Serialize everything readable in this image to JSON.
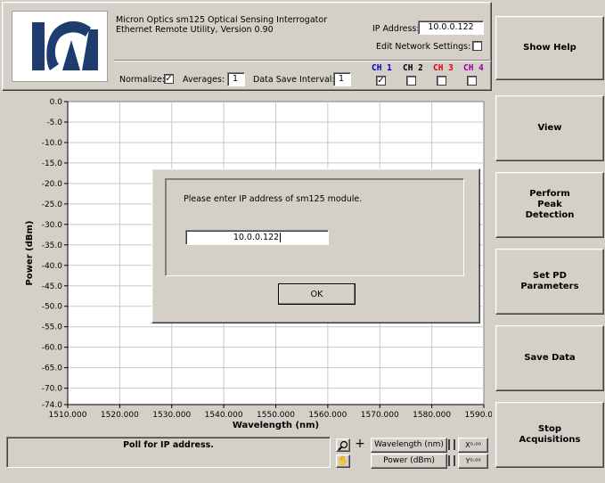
{
  "header": {
    "line1": "Micron Optics sm125 Optical Sensing Interrogator",
    "line2": "Ethernet Remote Utility, Version 0.90",
    "ip_label": "IP Address:",
    "ip_value": "10.0.0.122",
    "edit_net_label": "Edit Network Settings:",
    "normalize_label": "Normalize:",
    "averages_label": "Averages:",
    "averages_value": "1",
    "save_interval_label": "Data Save Interval:",
    "save_interval_value": "1",
    "channels": [
      {
        "label": "CH 1",
        "color": "#0000c0",
        "checked": true
      },
      {
        "label": "CH 2",
        "color": "#000000",
        "checked": false
      },
      {
        "label": "CH 3",
        "color": "#e00000",
        "checked": false
      },
      {
        "label": "CH 4",
        "color": "#a000a0",
        "checked": false
      }
    ]
  },
  "buttons": {
    "show_help": "Show Help",
    "view": "View",
    "peak": "Perform\nPeak\nDetection",
    "setpd": "Set PD\nParameters",
    "save": "Save Data",
    "stop": "Stop\nAcquisitions"
  },
  "chart_data": {
    "type": "line",
    "xlabel": "Wavelength (nm)",
    "ylabel": "Power (dBm)",
    "xlim": [
      1510,
      1590
    ],
    "ylim": [
      -74,
      0
    ],
    "x_ticks": [
      "1510.000",
      "1520.000",
      "1530.000",
      "1540.000",
      "1550.000",
      "1560.000",
      "1570.000",
      "1580.000",
      "1590.000"
    ],
    "y_ticks": [
      "0.0",
      "-5.0",
      "-10.0",
      "-15.0",
      "-20.0",
      "-25.0",
      "-30.0",
      "-35.0",
      "-40.0",
      "-45.0",
      "-50.0",
      "-55.0",
      "-60.0",
      "-65.0",
      "-70.0",
      "-74.0"
    ],
    "grid": true,
    "series": []
  },
  "dialog": {
    "prompt": "Please enter IP address of sm125 module.",
    "value": "10.0.0.122",
    "ok": "OK"
  },
  "status": {
    "message": "Poll for IP address.",
    "x_scale": "Wavelength (nm)",
    "y_scale": "Power (dBm)"
  }
}
